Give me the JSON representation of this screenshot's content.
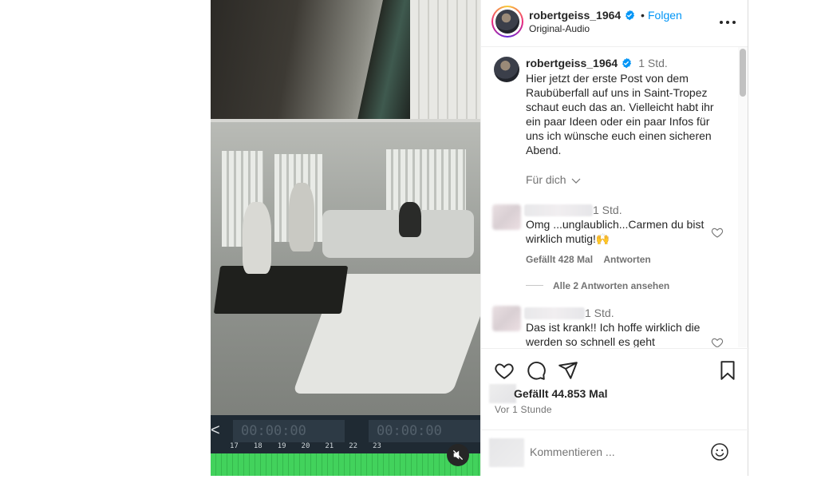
{
  "header": {
    "username": "robertgeiss_1964",
    "dot": "•",
    "follow_label": "Folgen",
    "audio": "Original-Audio"
  },
  "caption": {
    "username": "robertgeiss_1964",
    "time": "1 Std.",
    "text": "Hier jetzt der erste Post von dem Raubüberfall auf uns in Saint-Tropez schaut euch das an. Vielleicht habt ihr ein paar Ideen oder ein paar Infos für uns ich wünsche euch einen sicheren Abend.",
    "for_you": "Für dich"
  },
  "comments": [
    {
      "time": "1 Std.",
      "text": "Omg ...unglaublich...Carmen du bist wirklich mutig!🙌",
      "likes": "Gefällt 428 Mal",
      "reply": "Antworten",
      "view_replies": "Alle 2 Antworten ansehen"
    },
    {
      "time": "1 Std.",
      "text": "Das ist krank!! Ich hoffe wirklich die werden so schnell es geht"
    }
  ],
  "footer": {
    "likes": "Gefällt 44.853 Mal",
    "ago": "Vor 1 Stunde",
    "comment_placeholder": "Kommentieren ..."
  },
  "video": {
    "timecode_left": "00:00:00",
    "timecode_right": "00:00:00",
    "scale_ticks": [
      "17",
      "18",
      "19",
      "20",
      "21",
      "22",
      "23"
    ]
  },
  "colors": {
    "accent": "#0095f6",
    "verified": "#0095f6",
    "muted_text": "#737373"
  },
  "icons": [
    "verified-badge-icon",
    "more-icon",
    "chevron-down-icon",
    "heart-icon",
    "comment-icon",
    "share-icon",
    "bookmark-icon",
    "mute-icon",
    "emoji-icon"
  ]
}
